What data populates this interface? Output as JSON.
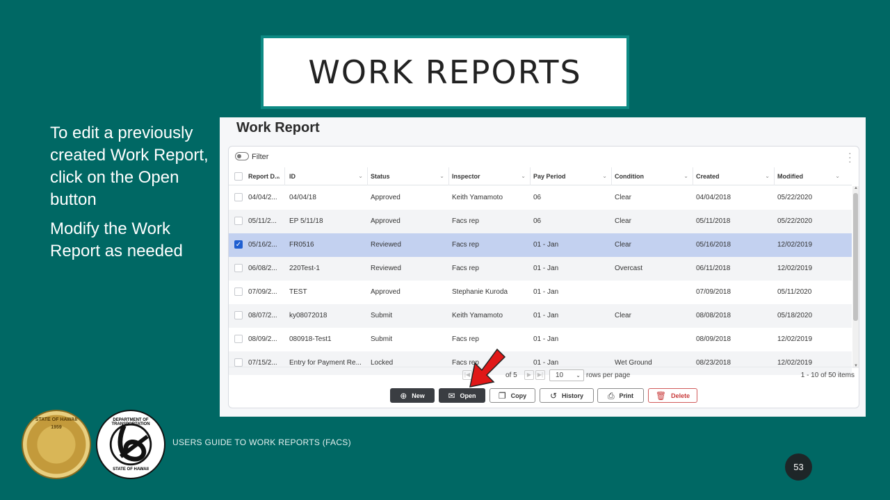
{
  "slide": {
    "title": "WORK REPORTS",
    "instructions": [
      "To edit a previously created Work Report, click on the Open button",
      "Modify the Work Report as needed"
    ],
    "footer": "USERS GUIDE TO WORK REPORTS  (FACS)",
    "page_number": "53",
    "seal1_text": "STATE OF HAWAII",
    "seal1_year": "1959",
    "seal2_text": "DEPARTMENT OF TRANSPORTATION",
    "seal2_sub": "STATE OF HAWAII"
  },
  "app": {
    "page_title": "Work Report",
    "filter_label": "Filter",
    "columns": [
      "Report D...",
      "ID",
      "Status",
      "Inspector",
      "Pay Period",
      "Condition",
      "Created",
      "Modified"
    ],
    "rows": [
      {
        "date": "04/04/2...",
        "id": "04/04/18",
        "status": "Approved",
        "inspector": "Keith Yamamoto",
        "pay_period": "06",
        "condition": "Clear",
        "created": "04/04/2018",
        "modified": "05/22/2020",
        "selected": false
      },
      {
        "date": "05/11/2...",
        "id": "EP 5/11/18",
        "status": "Approved",
        "inspector": "Facs rep",
        "pay_period": "06",
        "condition": "Clear",
        "created": "05/11/2018",
        "modified": "05/22/2020",
        "selected": false
      },
      {
        "date": "05/16/2...",
        "id": "FR0516",
        "status": "Reviewed",
        "inspector": "Facs rep",
        "pay_period": "01 - Jan",
        "condition": "Clear",
        "created": "05/16/2018",
        "modified": "12/02/2019",
        "selected": true
      },
      {
        "date": "06/08/2...",
        "id": "220Test-1",
        "status": "Reviewed",
        "inspector": "Facs rep",
        "pay_period": "01 - Jan",
        "condition": "Overcast",
        "created": "06/11/2018",
        "modified": "12/02/2019",
        "selected": false
      },
      {
        "date": "07/09/2...",
        "id": "TEST",
        "status": "Approved",
        "inspector": "Stephanie Kuroda",
        "pay_period": "01 - Jan",
        "condition": "",
        "created": "07/09/2018",
        "modified": "05/11/2020",
        "selected": false
      },
      {
        "date": "08/07/2...",
        "id": "ky08072018",
        "status": "Submit",
        "inspector": "Keith Yamamoto",
        "pay_period": "01 - Jan",
        "condition": "Clear",
        "created": "08/08/2018",
        "modified": "05/18/2020",
        "selected": false
      },
      {
        "date": "08/09/2...",
        "id": "080918-Test1",
        "status": "Submit",
        "inspector": "Facs rep",
        "pay_period": "01 - Jan",
        "condition": "",
        "created": "08/09/2018",
        "modified": "12/02/2019",
        "selected": false
      },
      {
        "date": "07/15/2...",
        "id": "Entry for Payment Re...",
        "status": "Locked",
        "inspector": "Facs rep",
        "pay_period": "01 - Jan",
        "condition": "Wet Ground",
        "created": "08/23/2018",
        "modified": "12/02/2019",
        "selected": false
      }
    ],
    "pager": {
      "of_pages": "of 5",
      "rows_per_page": "10",
      "rows_label": "rows per page",
      "items_label": "1 - 10 of 50 items"
    },
    "toolbar": {
      "new": "New",
      "open": "Open",
      "copy": "Copy",
      "history": "History",
      "print": "Print",
      "delete": "Delete"
    }
  }
}
